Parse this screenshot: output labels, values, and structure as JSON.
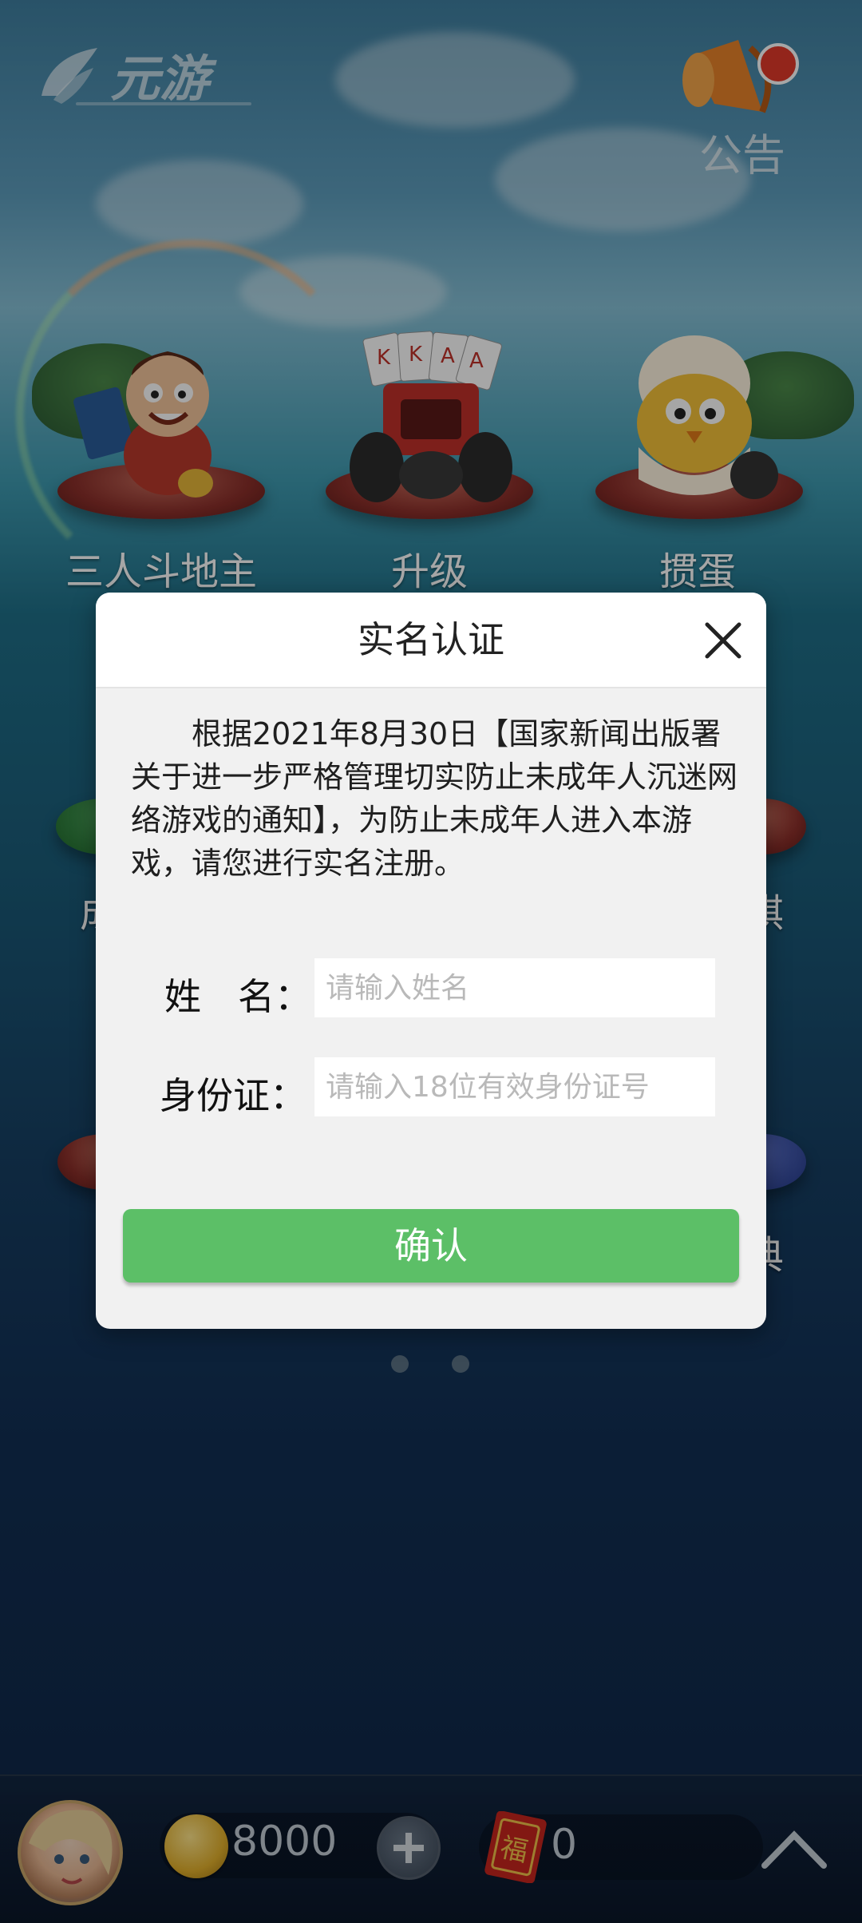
{
  "app": {
    "logo_text": "元游",
    "notice_label": "公告"
  },
  "games": [
    {
      "label": "三人斗地主"
    },
    {
      "label": "升级"
    },
    {
      "label": "掼蛋"
    }
  ],
  "background_partial_labels": {
    "left_row2": "成",
    "right_row2": "棋",
    "right_row3": "典"
  },
  "dialog": {
    "title": "实名认证",
    "message": "根据2021年8月30日【国家新闻出版署关于进一步严格管理切实防止未成年人沉迷网络游戏的通知】，为防止未成年人进入本游戏，请您进行实名注册。",
    "name_label": "姓　名：",
    "name_placeholder": "请输入姓名",
    "id_label": "身份证：",
    "id_placeholder": "请输入18位有效身份证号",
    "confirm_label": "确认"
  },
  "pagination": {
    "pages": 2,
    "current": 1
  },
  "bottom_bar": {
    "coins": "8000",
    "fu_count": "0"
  },
  "colors": {
    "confirm_green": "#5cbf67",
    "pedestal_red": "#8b2f2a"
  }
}
